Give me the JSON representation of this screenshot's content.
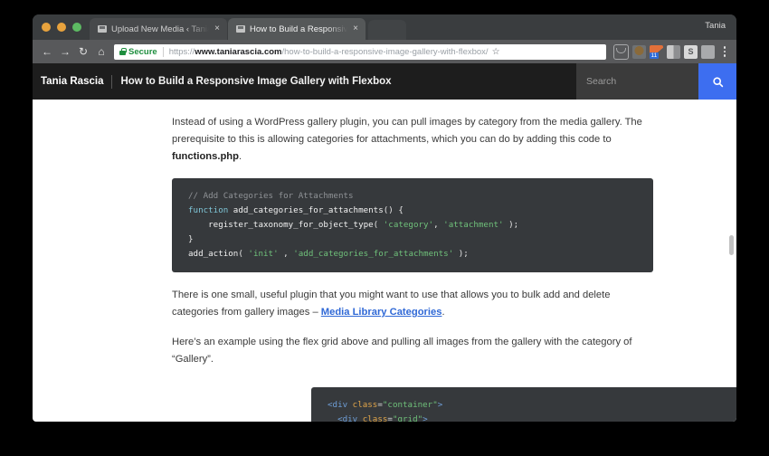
{
  "window": {
    "traffic_lights": [
      "close",
      "minimize",
      "zoom"
    ],
    "profile_name": "Tania"
  },
  "tabs": [
    {
      "title": "Upload New Media ‹ Tania Ras",
      "close_label": "×",
      "active": false,
      "favicon": "page-favicon"
    },
    {
      "title": "How to Build a Responsive Ima",
      "close_label": "×",
      "active": true,
      "favicon": "page-favicon"
    }
  ],
  "toolbar": {
    "back_label": "←",
    "forward_label": "→",
    "reload_label": "↻",
    "home_label": "⌂",
    "secure_label": "Secure",
    "url_scheme": "https://",
    "url_host": "www.taniarascia.com",
    "url_path": "/how-to-build-a-responsive-image-gallery-with-flexbox/",
    "star_label": "☆",
    "extensions": [
      {
        "name": "pocket-extension-icon"
      },
      {
        "name": "monkey-extension-icon"
      },
      {
        "name": "badge-extension-icon",
        "badge": "11"
      },
      {
        "name": "gray-panel-extension-icon"
      },
      {
        "name": "s-extension-icon",
        "label": "S"
      },
      {
        "name": "dotted-extension-icon"
      }
    ],
    "menu_label": "⋮"
  },
  "site": {
    "brand": "Tania Rascia",
    "page_title": "How to Build a Responsive Image Gallery with Flexbox",
    "search_placeholder": "Search",
    "search_value": "",
    "search_button_label": "search-icon",
    "accent_color": "#3d6ef0",
    "header_bg": "#1d1d1d"
  },
  "article": {
    "paragraph_1_part_1": "Instead of using a WordPress gallery plugin, you can pull images by category from the media gallery. The prerequisite to this is allowing categories for attachments, which you can do by adding this code to ",
    "paragraph_1_code": "functions.php",
    "paragraph_1_part_2": ".",
    "code_block_1": {
      "language": "php",
      "lines": [
        [
          {
            "t": "// Add Categories for Attachments",
            "c": "comment"
          }
        ],
        [
          {
            "t": "function ",
            "c": "keyword"
          },
          {
            "t": "add_categories_for_attachments",
            "c": "fn"
          },
          {
            "t": "() {",
            "c": "punct"
          }
        ],
        [
          {
            "t": "    register_taxonomy_for_object_type",
            "c": "fn"
          },
          {
            "t": "( ",
            "c": "punct"
          },
          {
            "t": "'category'",
            "c": "string"
          },
          {
            "t": ", ",
            "c": "punct"
          },
          {
            "t": "'attachment'",
            "c": "string"
          },
          {
            "t": " );",
            "c": "punct"
          }
        ],
        [
          {
            "t": "}",
            "c": "punct"
          }
        ],
        [
          {
            "t": "add_action",
            "c": "fn"
          },
          {
            "t": "( ",
            "c": "punct"
          },
          {
            "t": "'init'",
            "c": "string"
          },
          {
            "t": " , ",
            "c": "punct"
          },
          {
            "t": "'add_categories_for_attachments'",
            "c": "string"
          },
          {
            "t": " );",
            "c": "punct"
          }
        ]
      ]
    },
    "paragraph_2_part_1": "There is one small, useful plugin that you might want to use that allows you to bulk add and delete categories from gallery images – ",
    "paragraph_2_link": "Media Library Categories",
    "paragraph_2_part_2": ".",
    "paragraph_3": "Here’s an example using the flex grid above and pulling all images from the gallery with the category of “Gallery”.",
    "code_block_2": {
      "language": "html",
      "lines": [
        [
          {
            "t": "<div ",
            "c": "tag"
          },
          {
            "t": "class",
            "c": "attr"
          },
          {
            "t": "=",
            "c": "plain"
          },
          {
            "t": "\"container\"",
            "c": "string"
          },
          {
            "t": ">",
            "c": "tag"
          }
        ],
        [
          {
            "t": "  <div ",
            "c": "tag"
          },
          {
            "t": "class",
            "c": "attr"
          },
          {
            "t": "=",
            "c": "plain"
          },
          {
            "t": "\"grid\"",
            "c": "string"
          },
          {
            "t": ">",
            "c": "tag"
          }
        ]
      ]
    }
  }
}
